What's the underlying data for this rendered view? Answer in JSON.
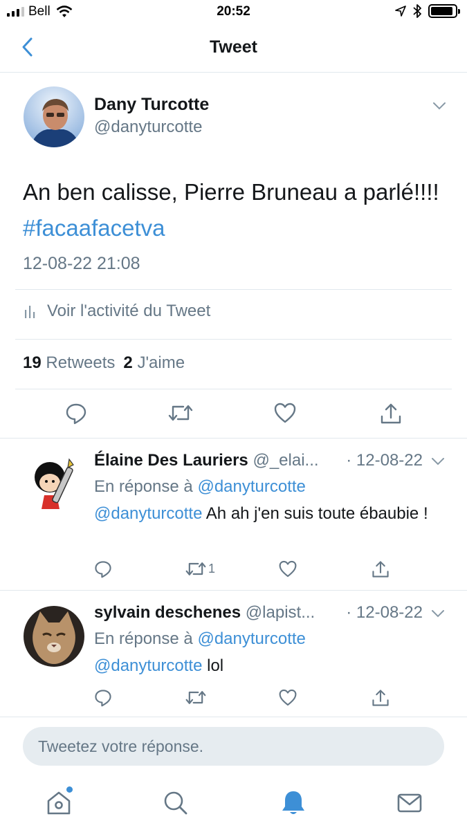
{
  "status_bar": {
    "carrier": "Bell",
    "time": "20:52",
    "signal_bars_active": 3,
    "battery_level": 0.92
  },
  "nav": {
    "title": "Tweet",
    "back_icon": "chevron-left-icon"
  },
  "tweet": {
    "author_name": "Dany Turcotte",
    "author_handle": "@danyturcotte",
    "text": "An ben calisse, Pierre Bruneau a parlé!!!!",
    "hashtag": "#facaafacetva",
    "timestamp": "12-08-22 21:08",
    "activity_label": "Voir l'activité du Tweet",
    "retweets_count": "19",
    "retweets_label": "Retweets",
    "likes_count": "2",
    "likes_label": "J'aime"
  },
  "replies": [
    {
      "name": "Élaine Des Lauriers",
      "handle": "@_elai...",
      "date": "· 12-08-22",
      "reply_to_prefix": "En réponse à",
      "reply_to_handle": "@danyturcotte",
      "mention": "@danyturcotte",
      "text": " Ah ah j'en suis toute ébaubie !",
      "retweet_count": "1"
    },
    {
      "name": "sylvain deschenes",
      "handle": "@lapist...",
      "date": "· 12-08-22",
      "reply_to_prefix": "En réponse à",
      "reply_to_handle": "@danyturcotte",
      "mention": "@danyturcotte",
      "text": " lol",
      "retweet_count": ""
    }
  ],
  "compose": {
    "placeholder": "Tweetez votre réponse."
  },
  "tab_bar": {
    "items": [
      "home-icon",
      "search-icon",
      "notifications-icon",
      "messages-icon"
    ],
    "active": "notifications-icon",
    "accent_color": "#3d8fd6"
  },
  "colors": {
    "link": "#3d8fd6",
    "secondary_text": "#657786",
    "primary_text": "#14171a"
  }
}
